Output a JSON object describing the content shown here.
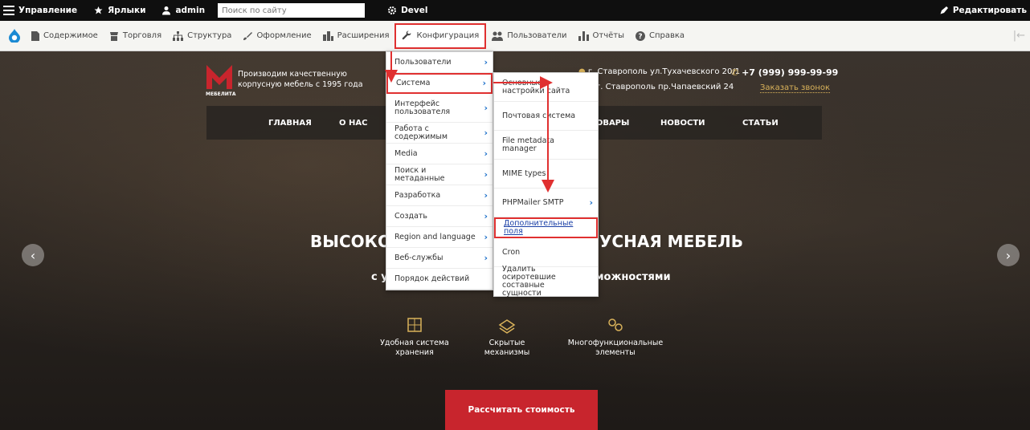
{
  "toolbar": {
    "manage": "Управление",
    "shortcuts": "Ярлыки",
    "user": "admin",
    "search_placeholder": "Поиск по сайту",
    "devel": "Devel",
    "edit": "Редактировать"
  },
  "tray": {
    "items": [
      "Содержимое",
      "Торговля",
      "Структура",
      "Оформление",
      "Расширения",
      "Конфигурация",
      "Пользователи",
      "Отчёты",
      "Справка"
    ],
    "active": "Конфигурация"
  },
  "config_menu": {
    "items": [
      {
        "label": "Пользователи",
        "has_submenu": true
      },
      {
        "label": "Система",
        "has_submenu": true,
        "highlighted": true
      },
      {
        "label": "Интерфейс пользователя",
        "has_submenu": true
      },
      {
        "label": "Работа с содержимым",
        "has_submenu": true
      },
      {
        "label": "Media",
        "has_submenu": true
      },
      {
        "label": "Поиск и метаданные",
        "has_submenu": true
      },
      {
        "label": "Разработка",
        "has_submenu": true
      },
      {
        "label": "Создать",
        "has_submenu": true
      },
      {
        "label": "Region and language",
        "has_submenu": true
      },
      {
        "label": "Веб-службы",
        "has_submenu": true
      },
      {
        "label": "Порядок действий",
        "has_submenu": false
      }
    ]
  },
  "system_menu": {
    "items": [
      {
        "label": "Основные настройки сайта",
        "has_submenu": false
      },
      {
        "label": "Почтовая система",
        "has_submenu": false
      },
      {
        "label": "File metadata manager",
        "has_submenu": false
      },
      {
        "label": "MIME types",
        "has_submenu": false
      },
      {
        "label": "PHPMailer SMTP",
        "has_submenu": true
      },
      {
        "label": "Дополнительные поля",
        "has_submenu": false,
        "highlighted": true
      },
      {
        "label": "Cron",
        "has_submenu": false
      },
      {
        "label": "Удалить осиротевшие составные сущности",
        "has_submenu": false
      }
    ]
  },
  "site": {
    "logo_text": "МЕБЕЛИТА",
    "tagline": "Производим качественную корпусную мебель с 1995 года",
    "address1": "г. Ставрополь ул.Тухачевского 20/1",
    "address2": "г. Ставрополь пр.Чапаевский 24",
    "phone": "+7 (999) 999-99-99",
    "callback": "Заказать звонок",
    "nav": [
      "ГЛАВНАЯ",
      "О НАС",
      "ТОВАРЫ",
      "НОВОСТИ",
      "СТАТЬИ"
    ],
    "hero_title_visible_left": "ВЫСОКО",
    "hero_title_visible_right": "УСНАЯ МЕБЕЛЬ",
    "hero_sub_visible_left": "с у",
    "hero_sub_visible_right": "циональными возможностями",
    "features": [
      "Удобная система хранения",
      "Скрытые механизмы",
      "Многофункциональные элементы"
    ],
    "cta": "Рассчитать стоимость",
    "arrow_left": "‹",
    "arrow_right": "›"
  },
  "colors": {
    "highlight": "#e03030",
    "cta": "#c8252d",
    "accent_link": "#d9b25a",
    "menu_chevron": "#1a6fc9"
  }
}
